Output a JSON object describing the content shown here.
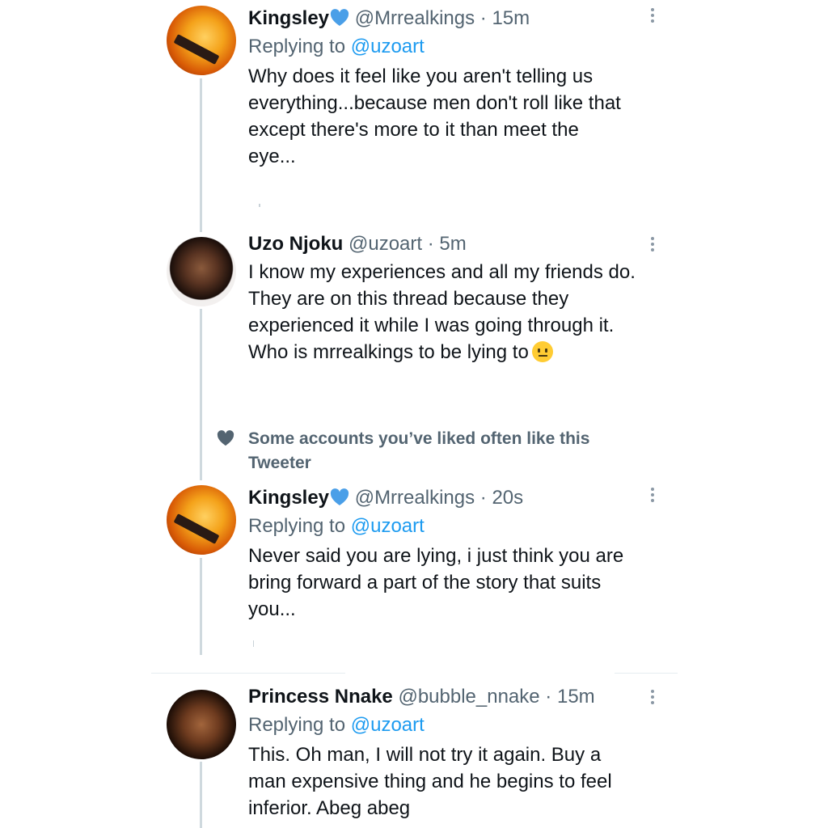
{
  "tweets": [
    {
      "name": "Kingsley",
      "handle": "@Mrrealkings",
      "time": "15m",
      "reply_prefix": "Replying to",
      "reply_mention": "@uzoart",
      "text_lines": [
        "Why does it feel like you aren't telling us",
        "everything...because men don't roll like that",
        "except there's more to it than meet the",
        "eye..."
      ]
    },
    {
      "name": "Uzo Njoku",
      "handle": "@uzoart",
      "time": "5m",
      "text_lines": [
        "I know my experiences and all my friends do.",
        "They are on this thread because they",
        "experienced it while I was going through it.",
        "Who is mrrealkings to be lying to"
      ]
    },
    {
      "name": "Kingsley",
      "handle": "@Mrrealkings",
      "time": "20s",
      "reply_prefix": "Replying to",
      "reply_mention": "@uzoart",
      "text_lines": [
        "Never said you are lying, i just think you are",
        "bring forward a part of the story that suits",
        "you..."
      ]
    },
    {
      "name": "Princess Nnake",
      "handle": "@bubble_nnake",
      "time": "15m",
      "reply_prefix": "Replying to",
      "reply_mention": "@uzoart",
      "text_lines": [
        "This. Oh man, I will not try it again. Buy a",
        "man expensive thing and he begins to feel",
        "inferior. Abeg abeg"
      ]
    }
  ],
  "social_context": {
    "line1": "Some accounts you’ve liked often like this",
    "line2": "Tweeter"
  },
  "separator": "·",
  "icons": {
    "verified": "verified-badge-icon",
    "more": "more-options-icon",
    "heart": "heart-icon",
    "emoji": "neutral-face-emoji"
  },
  "colors": {
    "link": "#1d9bf0",
    "secondary": "#536471",
    "verified": "#4a9fe8",
    "thread_line": "#cfd9de"
  }
}
